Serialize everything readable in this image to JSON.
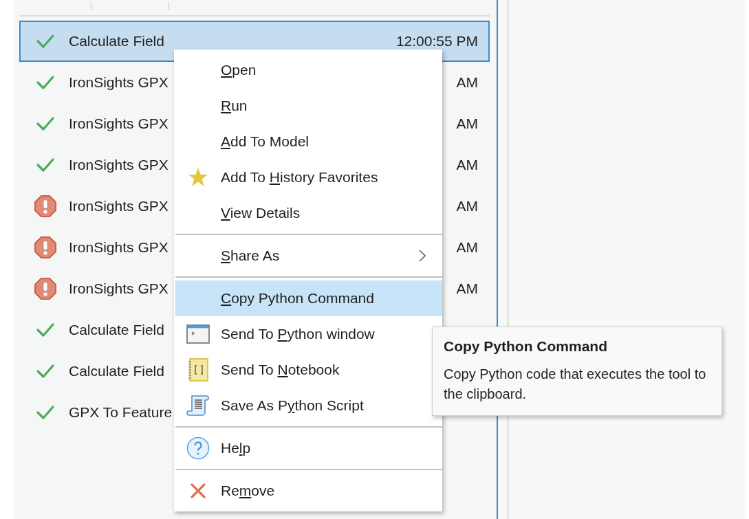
{
  "history_list": {
    "rows": [
      {
        "kind": "success",
        "name": "Calculate Field",
        "time": "12:00:55 PM",
        "selected": true
      },
      {
        "kind": "success",
        "name": "IronSights GPX",
        "time": "AM",
        "selected": false
      },
      {
        "kind": "success",
        "name": "IronSights GPX",
        "time": "AM",
        "selected": false
      },
      {
        "kind": "success",
        "name": "IronSights GPX",
        "time": "AM",
        "selected": false
      },
      {
        "kind": "error",
        "name": "IronSights GPX",
        "time": "AM",
        "selected": false
      },
      {
        "kind": "error",
        "name": "IronSights GPX",
        "time": "AM",
        "selected": false
      },
      {
        "kind": "error",
        "name": "IronSights GPX",
        "time": "AM",
        "selected": false
      },
      {
        "kind": "success",
        "name": "Calculate Field",
        "selected": false
      },
      {
        "kind": "success",
        "name": "Calculate Field",
        "selected": false
      },
      {
        "kind": "success",
        "name": "GPX To Feature",
        "selected": false
      }
    ]
  },
  "context_menu": {
    "groups": [
      [
        {
          "kind": "plain",
          "key": "O",
          "after": "pen",
          "selected": false
        },
        {
          "kind": "plain",
          "key": "R",
          "after": "un",
          "selected": false
        },
        {
          "kind": "plain",
          "key": "A",
          "after": "dd To Model",
          "selected": false
        },
        {
          "kind": "star",
          "before": "Add To ",
          "key": "H",
          "after": "istory Favorites",
          "selected": false
        },
        {
          "kind": "plain",
          "key": "V",
          "after": "iew Details",
          "selected": false
        }
      ],
      [
        {
          "kind": "plain",
          "key": "S",
          "after": "hare As",
          "submenu": true,
          "selected": false
        }
      ],
      [
        {
          "kind": "plain",
          "key": "C",
          "after": "opy Python Command",
          "selected": true
        },
        {
          "kind": "terminal",
          "before": "Send To ",
          "key": "P",
          "after": "ython window",
          "selected": false
        },
        {
          "kind": "notebook",
          "before": "Send To ",
          "key": "N",
          "after": "otebook",
          "selected": false
        },
        {
          "kind": "scroll",
          "before": "Save As P",
          "key": "y",
          "after": "thon Script",
          "selected": false
        }
      ],
      [
        {
          "kind": "help",
          "before": "He",
          "key": "l",
          "after": "p",
          "selected": false
        }
      ],
      [
        {
          "kind": "remove",
          "before": "Re",
          "key": "m",
          "after": "ove",
          "selected": false
        }
      ]
    ]
  },
  "tooltip": {
    "title": "Copy Python Command",
    "text": "Copy Python code that executes the tool to the clipboard."
  }
}
